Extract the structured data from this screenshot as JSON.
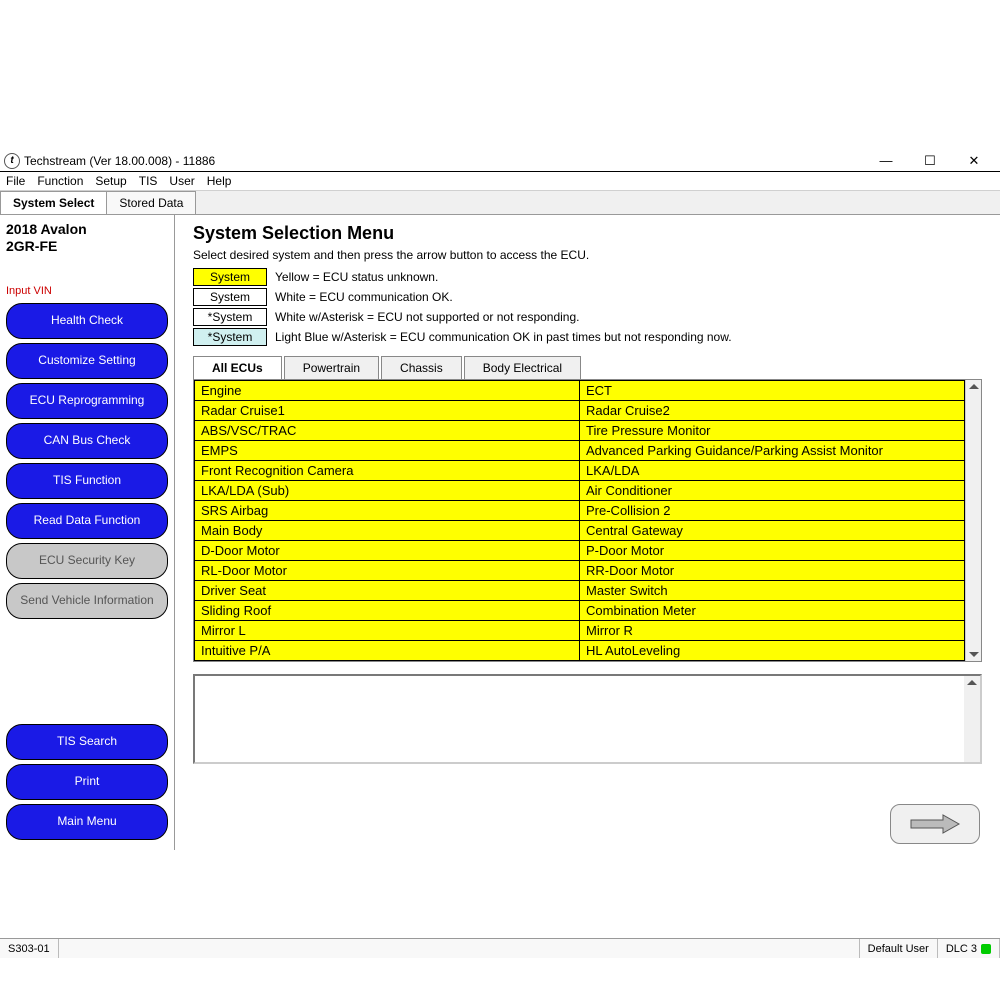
{
  "window": {
    "title": "Techstream (Ver 18.00.008) - 11886"
  },
  "menubar": [
    "File",
    "Function",
    "Setup",
    "TIS",
    "User",
    "Help"
  ],
  "top_tabs": {
    "system_select": "System Select",
    "stored_data": "Stored Data"
  },
  "sidebar": {
    "vehicle_line1": "2018 Avalon",
    "vehicle_line2": "2GR-FE",
    "input_vin": "Input VIN",
    "buttons": {
      "health_check": "Health Check",
      "customize_setting": "Customize Setting",
      "ecu_reprogramming": "ECU Reprogramming",
      "can_bus_check": "CAN Bus Check",
      "tis_function": "TIS Function",
      "read_data_function": "Read Data Function",
      "ecu_security_key": "ECU Security Key",
      "send_vehicle_info": "Send Vehicle Information",
      "tis_search": "TIS Search",
      "print": "Print",
      "main_menu": "Main Menu"
    }
  },
  "main": {
    "heading": "System Selection Menu",
    "instruction": "Select desired system and then press the arrow button to access the ECU.",
    "legend": {
      "yellow_label": "System",
      "yellow_desc": "Yellow = ECU status unknown.",
      "white_label": "System",
      "white_desc": "White = ECU communication OK.",
      "asterisk_label": "*System",
      "asterisk_desc": "White w/Asterisk = ECU not supported or not responding.",
      "lightblue_label": "*System",
      "lightblue_desc": "Light Blue w/Asterisk = ECU communication OK in past times but not responding now."
    },
    "ecu_tabs": {
      "all": "All ECUs",
      "powertrain": "Powertrain",
      "chassis": "Chassis",
      "body": "Body Electrical"
    },
    "ecu_rows": [
      {
        "left": "Engine",
        "right": "ECT"
      },
      {
        "left": "Radar Cruise1",
        "right": "Radar Cruise2"
      },
      {
        "left": "ABS/VSC/TRAC",
        "right": "Tire Pressure Monitor"
      },
      {
        "left": "EMPS",
        "right": "Advanced Parking Guidance/Parking Assist Monitor"
      },
      {
        "left": "Front Recognition Camera",
        "right": "LKA/LDA"
      },
      {
        "left": "LKA/LDA (Sub)",
        "right": "Air Conditioner"
      },
      {
        "left": "SRS Airbag",
        "right": "Pre-Collision 2"
      },
      {
        "left": "Main Body",
        "right": "Central Gateway"
      },
      {
        "left": "D-Door Motor",
        "right": "P-Door Motor"
      },
      {
        "left": "RL-Door Motor",
        "right": "RR-Door Motor"
      },
      {
        "left": "Driver Seat",
        "right": "Master Switch"
      },
      {
        "left": "Sliding Roof",
        "right": "Combination Meter"
      },
      {
        "left": "Mirror L",
        "right": "Mirror R"
      },
      {
        "left": "Intuitive P/A",
        "right": "HL AutoLeveling"
      }
    ]
  },
  "status": {
    "code": "S303-01",
    "user": "Default User",
    "dlc": "DLC 3"
  }
}
